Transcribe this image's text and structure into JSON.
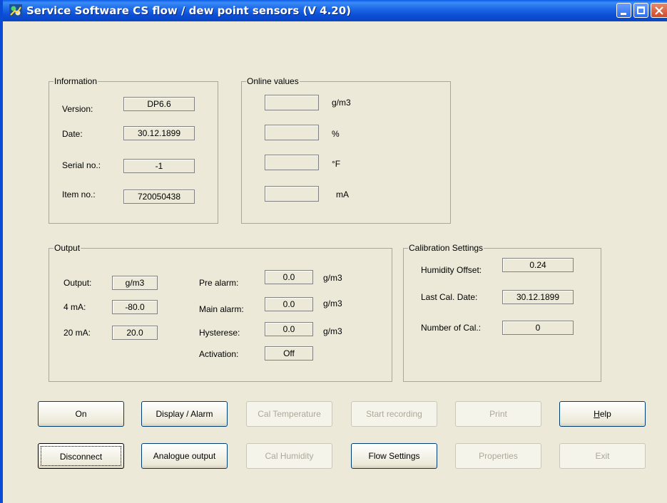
{
  "window": {
    "title": "Service Software CS flow / dew point sensors (V 4.20)"
  },
  "information": {
    "label": "Information",
    "rows": [
      {
        "label": "Version:",
        "value": "DP6.6"
      },
      {
        "label": "Date:",
        "value": "30.12.1899"
      },
      {
        "label": "Serial no.:",
        "value": "-1"
      },
      {
        "label": "Item no.:",
        "value": "720050438"
      }
    ]
  },
  "online": {
    "label": "Online values",
    "rows": [
      {
        "value": "",
        "unit": "g/m3"
      },
      {
        "value": "",
        "unit": "%"
      },
      {
        "value": "",
        "unit": "°F"
      },
      {
        "value": "",
        "unit": "mA"
      }
    ]
  },
  "output": {
    "label": "Output",
    "left": [
      {
        "label": "Output:",
        "value": "g/m3"
      },
      {
        "label": "4 mA:",
        "value": "-80.0"
      },
      {
        "label": "20 mA:",
        "value": "20.0"
      }
    ],
    "right": [
      {
        "label": "Pre alarm:",
        "value": "0.0",
        "unit": "g/m3"
      },
      {
        "label": "Main alarm:",
        "value": "0.0",
        "unit": "g/m3"
      },
      {
        "label": "Hysterese:",
        "value": "0.0",
        "unit": "g/m3"
      },
      {
        "label": "Activation:",
        "value": "Off",
        "unit": ""
      }
    ]
  },
  "calibration": {
    "label": "Calibration Settings",
    "rows": [
      {
        "label": "Humidity Offset:",
        "value": "0.24"
      },
      {
        "label": "Last Cal. Date:",
        "value": "30.12.1899"
      },
      {
        "label": "Number of Cal.:",
        "value": "0"
      }
    ]
  },
  "buttons": {
    "on": "On",
    "display_alarm": "Display / Alarm",
    "cal_temperature": "Cal Temperature",
    "start_recording": "Start recording",
    "print": "Print",
    "help_mnemonic": "H",
    "help_rest": "elp",
    "disconnect": "Disconnect",
    "analogue_output": "Analogue output",
    "cal_humidity": "Cal Humidity",
    "flow_settings": "Flow Settings",
    "properties": "Properties",
    "exit": "Exit"
  }
}
